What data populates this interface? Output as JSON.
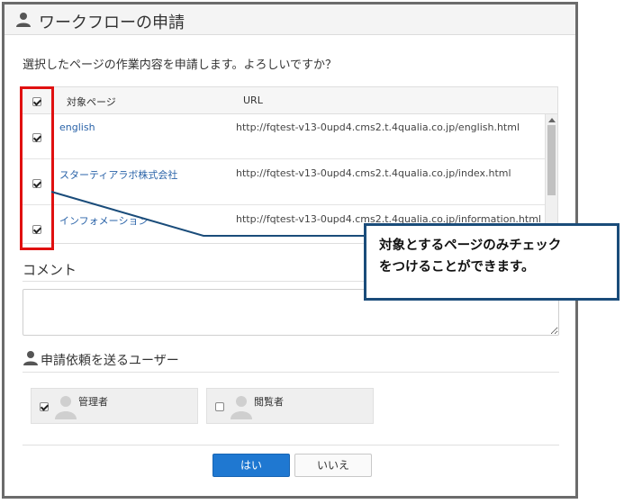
{
  "dialog": {
    "title": "ワークフローの申請",
    "intro": "選択したページの作業内容を申請します。よろしいですか？"
  },
  "table": {
    "headers": {
      "page": "対象ページ",
      "url": "URL"
    },
    "rows": [
      {
        "page": "english",
        "url": "http://fqtest-v13-0upd4.cms2.t.4qualia.co.jp/english.html",
        "checked": true
      },
      {
        "page": "スターティアラボ株式会社",
        "url": "http://fqtest-v13-0upd4.cms2.t.4qualia.co.jp/index.html",
        "checked": true
      },
      {
        "page": "インフォメーション",
        "url": "http://fqtest-v13-0upd4.cms2.t.4qualia.co.jp/information.html",
        "checked": true
      }
    ]
  },
  "comment": {
    "label": "コメント",
    "value": ""
  },
  "users": {
    "heading": "申請依頼を送るユーザー",
    "list": [
      {
        "name": "管理者",
        "checked": true
      },
      {
        "name": "閲覧者",
        "checked": false
      }
    ]
  },
  "buttons": {
    "yes": "はい",
    "no": "いいえ"
  },
  "callout": {
    "line1": "対象とするページのみチェック",
    "line2": "をつけることができます。"
  },
  "colors": {
    "highlight": "#e01010",
    "callout_border": "#1a4c7a",
    "primary_button": "#1f78d1",
    "link": "#2a63a8"
  },
  "icons": {
    "title": "user-icon",
    "users": "user-icon",
    "avatar": "avatar-icon"
  }
}
